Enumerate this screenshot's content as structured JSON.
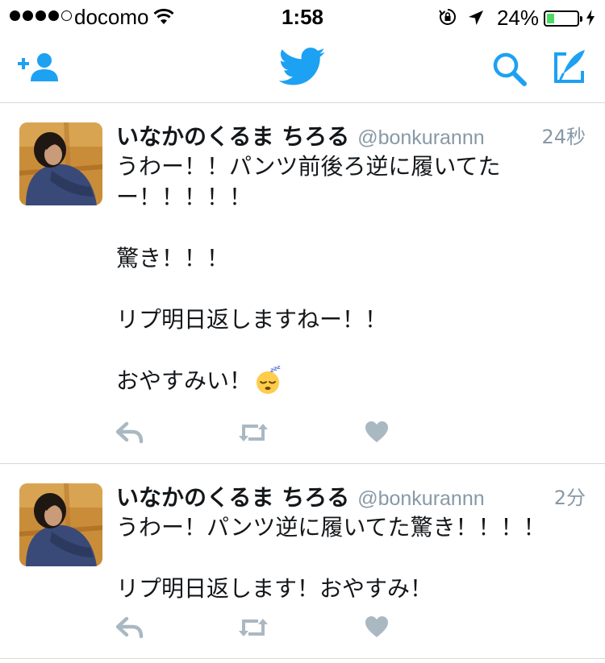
{
  "status_bar": {
    "carrier": "docomo",
    "time": "1:58",
    "battery_percent": "24%",
    "battery_level": 0.24,
    "signal_bars_filled": 4,
    "signal_bars_total": 5
  },
  "nav": {
    "icons": [
      "add-user-icon",
      "twitter-bird-icon",
      "search-icon",
      "compose-icon"
    ],
    "accent_color": "#1da1f2"
  },
  "tweets": [
    {
      "display_name": "いなかのくるま ちろる",
      "handle": "@bonkurannn",
      "time": "24秒",
      "text": "うわー！！パンツ前後ろ逆に履いてた\nー！！！！！\n\n驚き！！！\n\nリプ明日返しますねー！！\n\nおやすみい！",
      "emoji": "sleeping-face-icon"
    },
    {
      "display_name": "いなかのくるま ちろる",
      "handle": "@bonkurannn",
      "time": "2分",
      "text": "うわー！パンツ逆に履いてた驚き！！！！\n\nリプ明日返します！おやすみ！"
    }
  ],
  "colors": {
    "accent": "#1da1f2",
    "secondary_text": "#8899a6",
    "action_icon": "#aab8c2",
    "divider": "#d8d8d8",
    "battery_fill": "#4cd964"
  }
}
